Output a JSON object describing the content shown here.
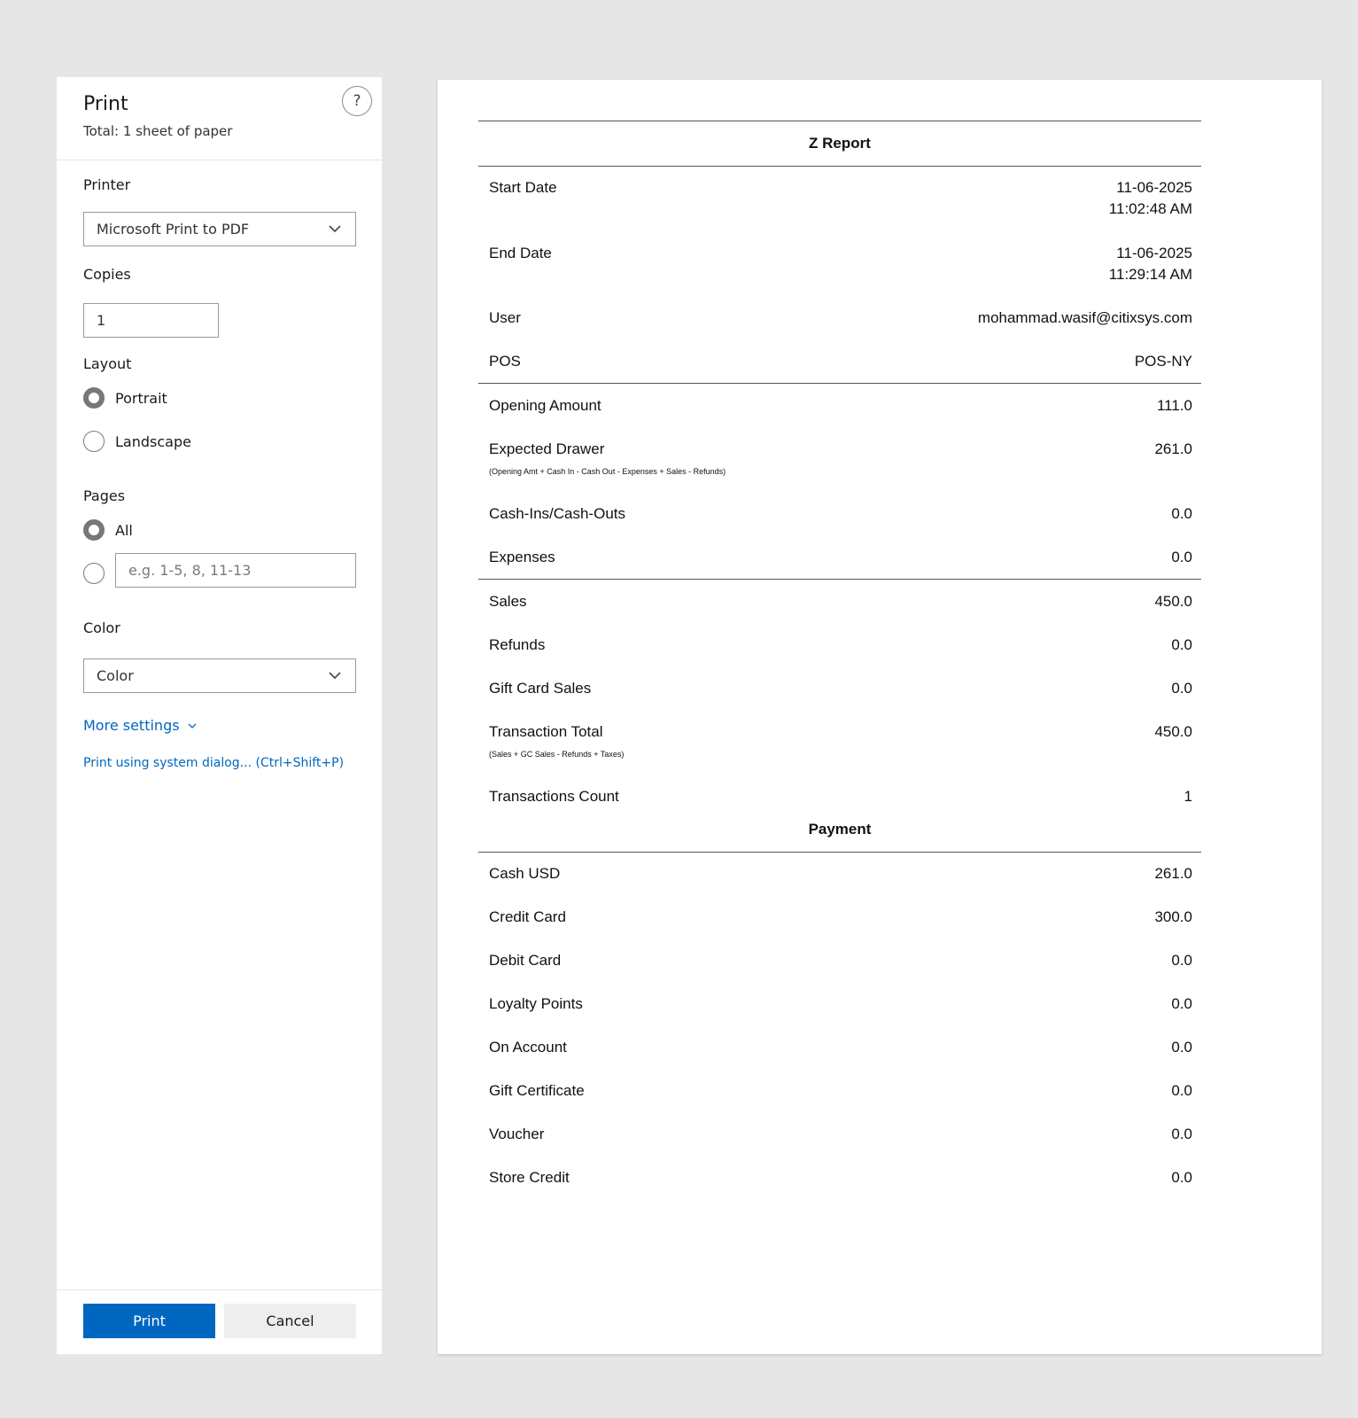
{
  "dialog": {
    "title": "Print",
    "subtitle": "Total: 1 sheet of paper",
    "help": "?",
    "printer_label": "Printer",
    "printer_value": "Microsoft Print to PDF",
    "copies_label": "Copies",
    "copies_value": "1",
    "layout_label": "Layout",
    "layout_portrait": "Portrait",
    "layout_landscape": "Landscape",
    "pages_label": "Pages",
    "pages_all": "All",
    "pages_custom_placeholder": "e.g. 1-5, 8, 11-13",
    "color_label": "Color",
    "color_value": "Color",
    "more_settings": "More settings",
    "system_dialog": "Print using system dialog... (Ctrl+Shift+P)",
    "print_button": "Print",
    "cancel_button": "Cancel",
    "accent_color": "#0067c0"
  },
  "report": {
    "title": "Z Report",
    "start_date_label": "Start Date",
    "start_date_line1": "11-06-2025",
    "start_date_line2": "11:02:48 AM",
    "end_date_label": "End Date",
    "end_date_line1": "11-06-2025",
    "end_date_line2": "11:29:14 AM",
    "user_label": "User",
    "user_value": "mohammad.wasif@citixsys.com",
    "pos_label": "POS",
    "pos_value": "POS-NY",
    "opening_label": "Opening Amount",
    "opening_value": "111.0",
    "expected_label": "Expected Drawer",
    "expected_value": "261.0",
    "expected_note": "(Opening Amt + Cash In - Cash Out - Expenses + Sales - Refunds)",
    "cashins_label": "Cash-Ins/Cash-Outs",
    "cashins_value": "0.0",
    "expenses_label": "Expenses",
    "expenses_value": "0.0",
    "sales_label": "Sales",
    "sales_value": "450.0",
    "refunds_label": "Refunds",
    "refunds_value": "0.0",
    "giftcard_label": "Gift Card Sales",
    "giftcard_value": "0.0",
    "txtotal_label": "Transaction Total",
    "txtotal_value": "450.0",
    "txtotal_note": "(Sales + GC Sales - Refunds + Taxes)",
    "txcount_label": "Transactions Count",
    "txcount_value": "1",
    "payment_title": "Payment",
    "cash_label": "Cash USD",
    "cash_value": "261.0",
    "credit_label": "Credit Card",
    "credit_value": "300.0",
    "debit_label": "Debit Card",
    "debit_value": "0.0",
    "loyalty_label": "Loyalty Points",
    "loyalty_value": "0.0",
    "account_label": "On Account",
    "account_value": "0.0",
    "giftcert_label": "Gift Certificate",
    "giftcert_value": "0.0",
    "voucher_label": "Voucher",
    "voucher_value": "0.0",
    "storecredit_label": "Store Credit",
    "storecredit_value": "0.0"
  }
}
